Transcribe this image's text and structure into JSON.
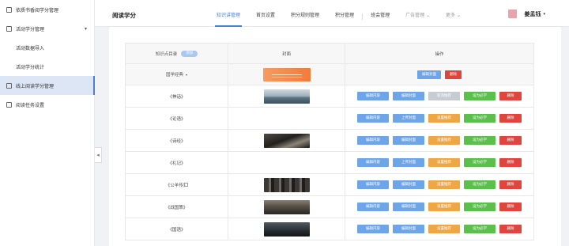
{
  "sidebar": {
    "items": [
      {
        "label": "依质书香阅学分管理",
        "type": "top"
      },
      {
        "label": "活动学分管理",
        "type": "top",
        "expanded": true
      },
      {
        "label": "活动数据导入",
        "type": "sub"
      },
      {
        "label": "活动学分统计",
        "type": "sub"
      },
      {
        "label": "线上阅读学分管理",
        "type": "top",
        "active": true
      },
      {
        "label": "阅读任务设置",
        "type": "top"
      }
    ],
    "caret": "▾",
    "collapse": "◂"
  },
  "header": {
    "title": "阅读学分",
    "tabs": [
      "知识讲管理",
      "首页设置",
      "积分规则管理",
      "积分管理",
      "班会管理",
      "广告管理",
      "更多"
    ],
    "user_name": "姜孟钰",
    "caret": "▾"
  },
  "table": {
    "headers": {
      "col1": "知识点目录",
      "col1_pill": "添加",
      "col2": "封面",
      "col3": "操作"
    },
    "category": "国学经典",
    "category_caret": "▾",
    "head_buttons": [
      "编辑封面",
      "删除"
    ],
    "rows": [
      {
        "name": "《神话》",
        "cover": "lake",
        "buttons": [
          "编辑内容",
          "编辑封面",
          "取消推荐",
          "设为必学",
          "删除"
        ]
      },
      {
        "name": "《论语》",
        "cover": "",
        "buttons": [
          "编辑内容",
          "上传封面",
          "设置推荐",
          "设为必学",
          "删除"
        ]
      },
      {
        "name": "《诗经》",
        "cover": "dark1",
        "buttons": [
          "编辑内容",
          "编辑封面",
          "设置推荐",
          "设为必学",
          "删除"
        ]
      },
      {
        "name": "《礼记》",
        "cover": "",
        "buttons": [
          "编辑内容",
          "上传封面",
          "设置推荐",
          "设为必学",
          "删除"
        ]
      },
      {
        "name": "《公羊传》",
        "cover": "dark2",
        "edit_icon": true,
        "buttons": [
          "编辑内容",
          "编辑封面",
          "设置推荐",
          "设为必学",
          "删除"
        ]
      },
      {
        "name": "《战国策》",
        "cover": "dark3",
        "buttons": [
          "编辑内容",
          "编辑封面",
          "设置推荐",
          "设为必学",
          "删除"
        ]
      },
      {
        "name": "《国语》",
        "cover": "dark4",
        "buttons": [
          "编辑内容",
          "编辑封面",
          "设置推荐",
          "设为必学",
          "删除"
        ]
      }
    ]
  },
  "colors": {
    "accent": "#4a7fd4",
    "blue_btn": "#6ea4e8",
    "orange_btn": "#efa745",
    "grey_btn": "#c6ccd4",
    "green_btn": "#5bbf4c",
    "red_btn": "#e0453d"
  }
}
